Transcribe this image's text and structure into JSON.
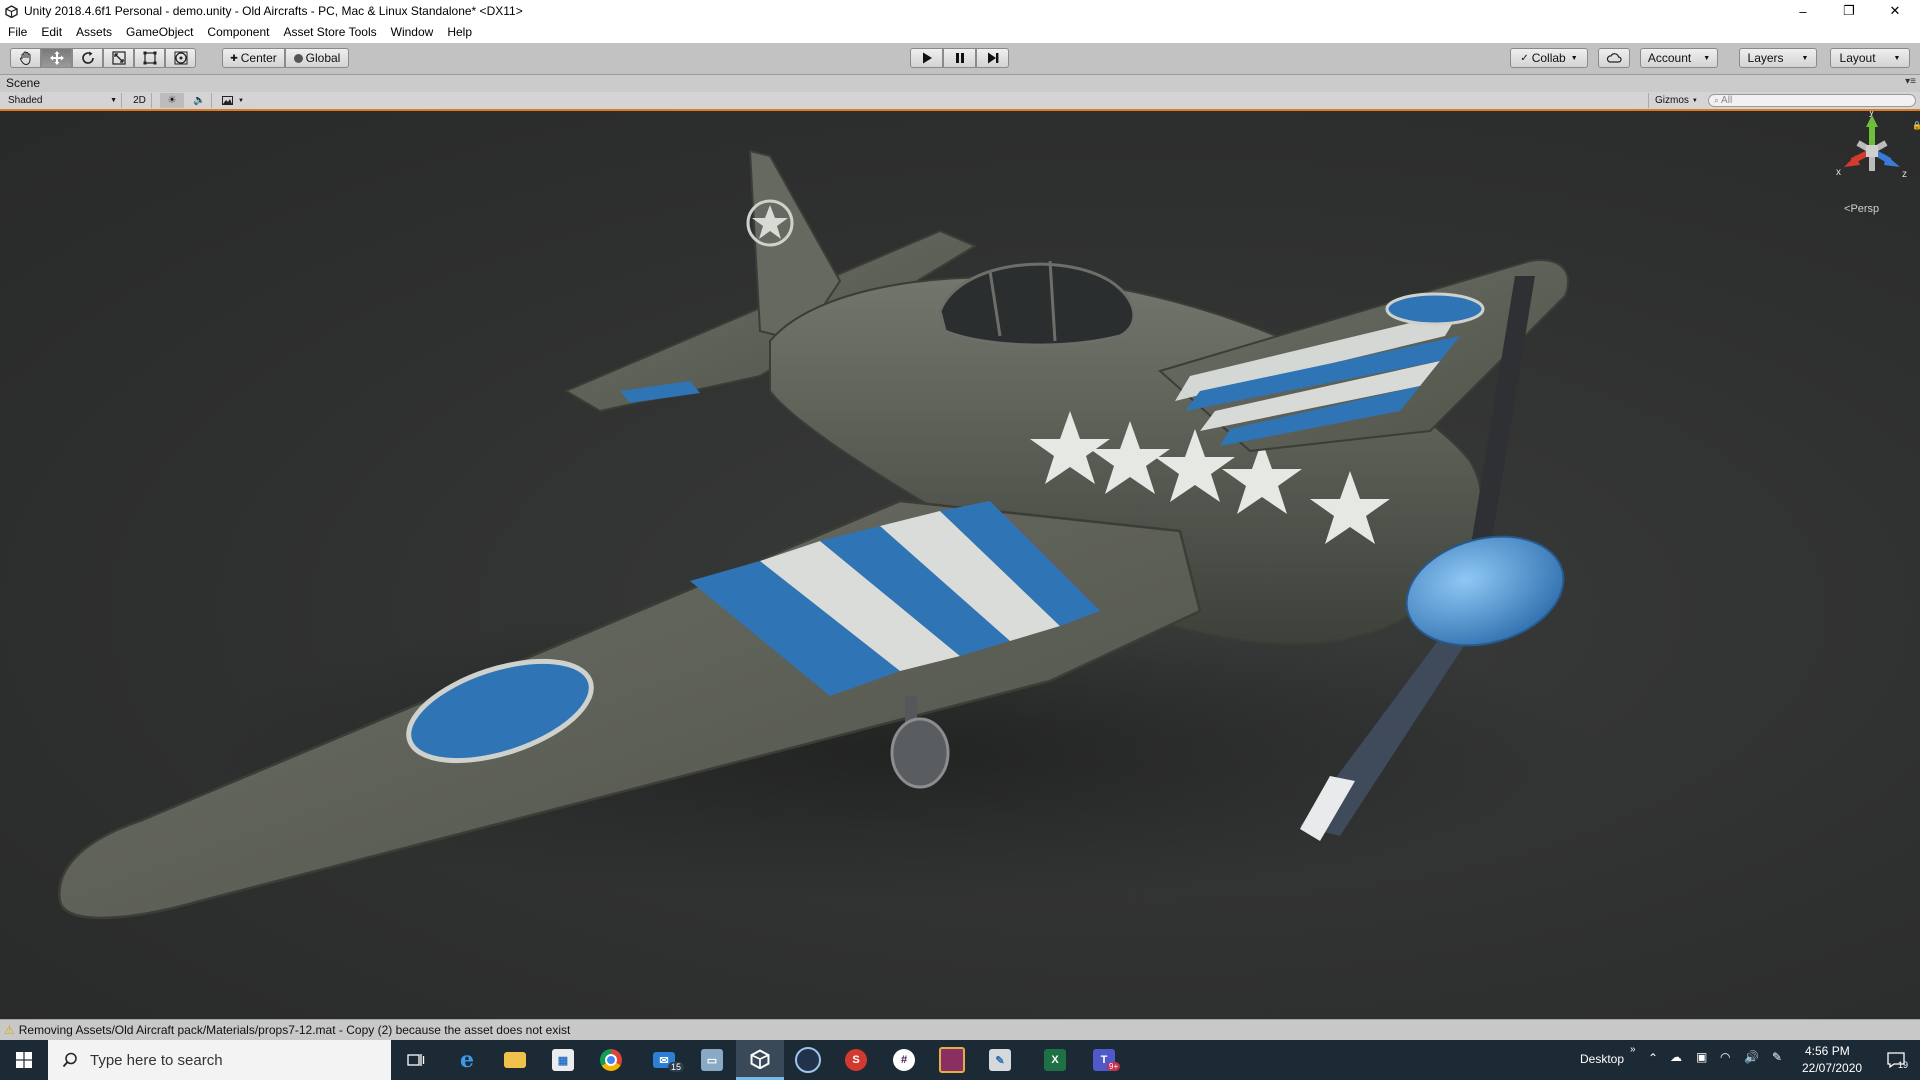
{
  "window": {
    "title": "Unity 2018.4.6f1 Personal - demo.unity - Old Aircrafts - PC, Mac & Linux Standalone* <DX11>",
    "controls": [
      "–",
      "❐",
      "✕"
    ]
  },
  "menu": [
    "File",
    "Edit",
    "Assets",
    "GameObject",
    "Component",
    "Asset Store Tools",
    "Window",
    "Help"
  ],
  "toolbar": {
    "pivot_mode": "Center",
    "pivot_rotation": "Global",
    "collab": "Collab",
    "account": "Account",
    "layers": "Layers",
    "layout": "Layout",
    "tools": [
      "hand-tool-icon",
      "move-tool-icon",
      "rotate-tool-icon",
      "scale-tool-icon",
      "rect-tool-icon",
      "transform-tool-icon"
    ]
  },
  "scene": {
    "tab_label": "Scene",
    "draw_mode": "Shaded",
    "toggle_2d": "2D",
    "gizmos": "Gizmos",
    "search_placeholder": "All",
    "projection": "Persp",
    "axis_labels": {
      "y": "y",
      "x": "x",
      "z": "z"
    }
  },
  "status": {
    "message": "Removing Assets/Old Aircraft pack/Materials/props7-12.mat - Copy (2) because the asset does not exist"
  },
  "taskbar": {
    "search_placeholder": "Type here to search",
    "desktop_label": "Desktop",
    "time": "4:56 PM",
    "date": "22/07/2020",
    "mail_badge": "15",
    "teams_badge": "9+",
    "notification_count": "19"
  }
}
